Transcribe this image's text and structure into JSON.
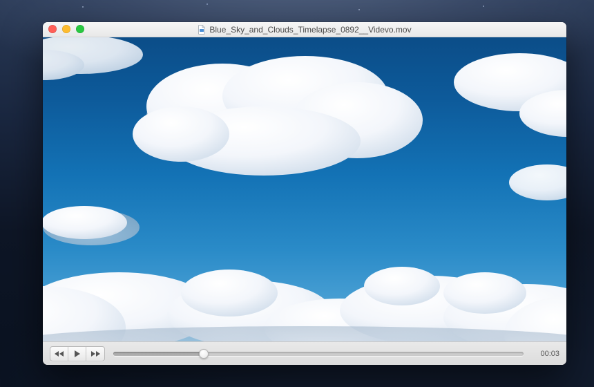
{
  "window": {
    "title": "Blue_Sky_and_Clouds_Timelapse_0892__Videvo.mov"
  },
  "playback": {
    "time_display": "00:03",
    "progress_percent": 22
  },
  "icons": {
    "rewind": "rewind-icon",
    "play": "play-icon",
    "fast_forward": "fast-forward-icon",
    "document": "document-icon"
  },
  "colors": {
    "traffic_close": "#ff5f57",
    "traffic_min": "#febc2e",
    "traffic_zoom": "#28c840"
  }
}
